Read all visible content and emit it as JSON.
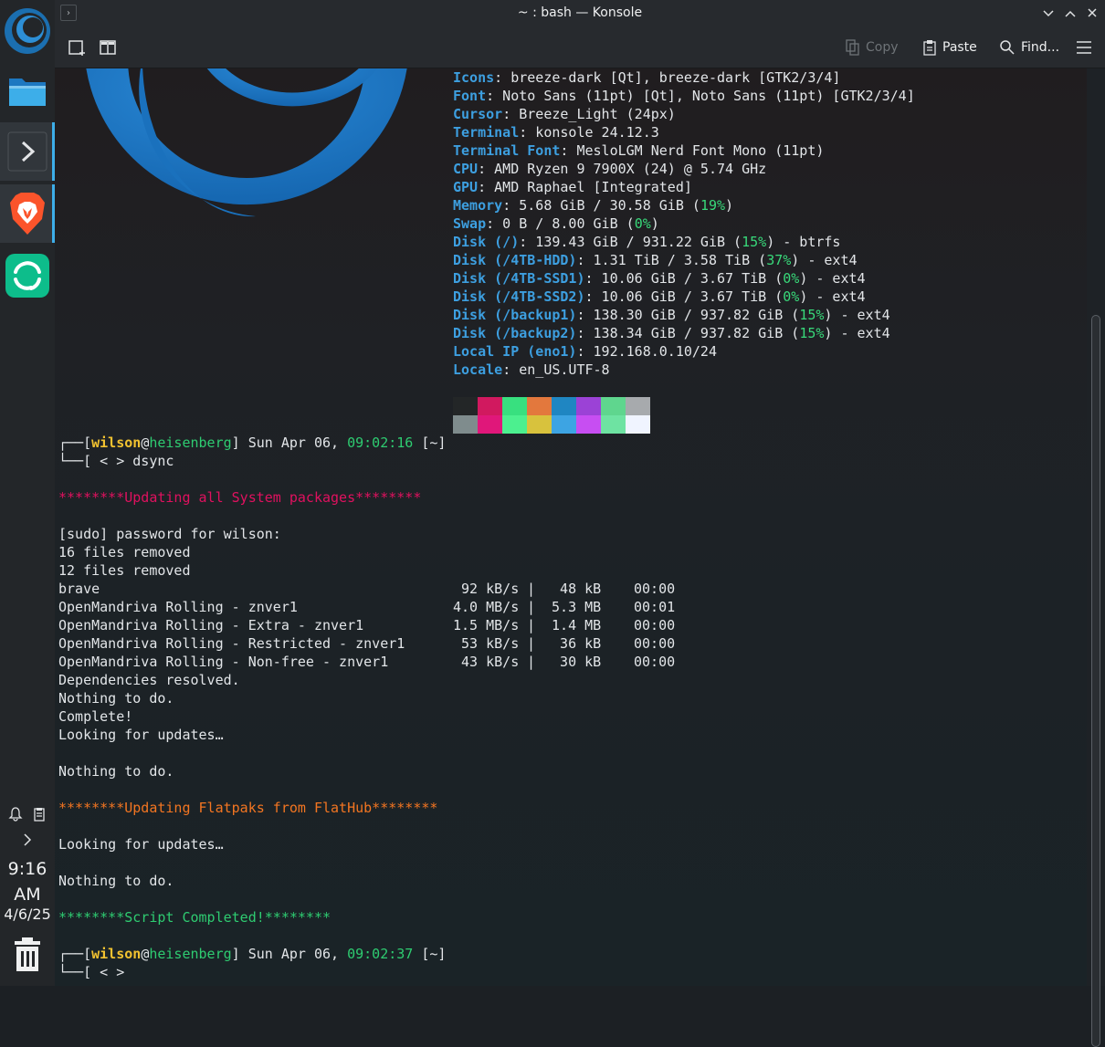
{
  "window": {
    "title": "~ : bash — Konsole",
    "toolbar": {
      "copy": "Copy",
      "paste": "Paste",
      "find": "Find..."
    }
  },
  "panel": {
    "launchers": [
      "openmandriva-icon",
      "file-manager-icon",
      "konsole-icon",
      "brave-icon",
      "element-icon"
    ],
    "clock": {
      "time": "9:16 AM",
      "date": "4/6/25"
    }
  },
  "sysinfo": [
    {
      "key": "Icons",
      "value": ": breeze-dark [Qt], breeze-dark [GTK2/3/4]"
    },
    {
      "key": "Font",
      "value": ": Noto Sans (11pt) [Qt], Noto Sans (11pt) [GTK2/3/4]"
    },
    {
      "key": "Cursor",
      "value": ": Breeze_Light (24px)"
    },
    {
      "key": "Terminal",
      "value": ": konsole 24.12.3"
    },
    {
      "key": "Terminal Font",
      "value": ": MesloLGM Nerd Font Mono (11pt)"
    },
    {
      "key": "CPU",
      "value": ": AMD Ryzen 9 7900X (24) @ 5.74 GHz"
    },
    {
      "key": "GPU",
      "value": ": AMD Raphael [Integrated]"
    },
    {
      "key": "Memory",
      "value": ": 5.68 GiB / 30.58 GiB (",
      "pct": "19%",
      "tail": ")"
    },
    {
      "key": "Swap",
      "value": ": 0 B / 8.00 GiB (",
      "pct": "0%",
      "tail": ")"
    },
    {
      "key": "Disk (/)",
      "value": ": 139.43 GiB / 931.22 GiB (",
      "pct": "15%",
      "tail": ") - btrfs"
    },
    {
      "key": "Disk (/4TB-HDD)",
      "value": ": 1.31 TiB / 3.58 TiB (",
      "pct": "37%",
      "tail": ") - ext4"
    },
    {
      "key": "Disk (/4TB-SSD1)",
      "value": ": 10.06 GiB / 3.67 TiB (",
      "pct": "0%",
      "tail": ") - ext4"
    },
    {
      "key": "Disk (/4TB-SSD2)",
      "value": ": 10.06 GiB / 3.67 TiB (",
      "pct": "0%",
      "tail": ") - ext4"
    },
    {
      "key": "Disk (/backup1)",
      "value": ": 138.30 GiB / 937.82 GiB (",
      "pct": "15%",
      "tail": ") - ext4"
    },
    {
      "key": "Disk (/backup2)",
      "value": ": 138.34 GiB / 937.82 GiB (",
      "pct": "15%",
      "tail": ") - ext4"
    },
    {
      "key": "Local IP (eno1)",
      "value": ": 192.168.0.10/24"
    },
    {
      "key": "Locale",
      "value": ": en_US.UTF-8"
    }
  ],
  "palette": {
    "top": [
      "#232627",
      "#d1195f",
      "#38e07f",
      "#e3783d",
      "#1f86c2",
      "#9b42d6",
      "#5fd68e",
      "#a7aaad"
    ],
    "bottom": [
      "#7f8c8d",
      "#e0177a",
      "#4cf08f",
      "#d8c23d",
      "#3da4e3",
      "#c74ef2",
      "#6ee3a2",
      "#f0f4ff"
    ]
  },
  "prompt1": {
    "open": "┌──[",
    "user": "wilson",
    "at": "@",
    "host": "heisenberg",
    "date": "] Sun Apr 06, ",
    "time": "09:02:16",
    "dir": " [~]",
    "cmdline": "└──[ < > dsync"
  },
  "updating_system": "********Updating all System packages********",
  "sudo_lines": [
    "[sudo] password for wilson:",
    "16 files removed",
    "12 files removed"
  ],
  "repos": [
    {
      "name": "brave",
      "speed": " 92 kB/s",
      "size": "  48 kB",
      "time": "00:00"
    },
    {
      "name": "OpenMandriva Rolling - znver1",
      "speed": "4.0 MB/s",
      "size": " 5.3 MB",
      "time": "00:01"
    },
    {
      "name": "OpenMandriva Rolling - Extra - znver1",
      "speed": "1.5 MB/s",
      "size": " 1.4 MB",
      "time": "00:00"
    },
    {
      "name": "OpenMandriva Rolling - Restricted - znver1",
      "speed": " 53 kB/s",
      "size": "  36 kB",
      "time": "00:00"
    },
    {
      "name": "OpenMandriva Rolling - Non-free - znver1",
      "speed": " 43 kB/s",
      "size": "  30 kB",
      "time": "00:00"
    }
  ],
  "after_repos": [
    "Dependencies resolved.",
    "Nothing to do.",
    "Complete!",
    "Looking for updates…"
  ],
  "nothing1": "Nothing to do.",
  "updating_flatpaks": "********Updating Flatpaks from FlatHub********",
  "flat_looking": "Looking for updates…",
  "flat_nothing": "Nothing to do.",
  "completed": "********Script Completed!********",
  "prompt2": {
    "open": "┌──[",
    "user": "wilson",
    "at": "@",
    "host": "heisenberg",
    "date": "] Sun Apr 06, ",
    "time": "09:02:37",
    "dir": " [~]",
    "cmdline": "└──[ < >"
  }
}
